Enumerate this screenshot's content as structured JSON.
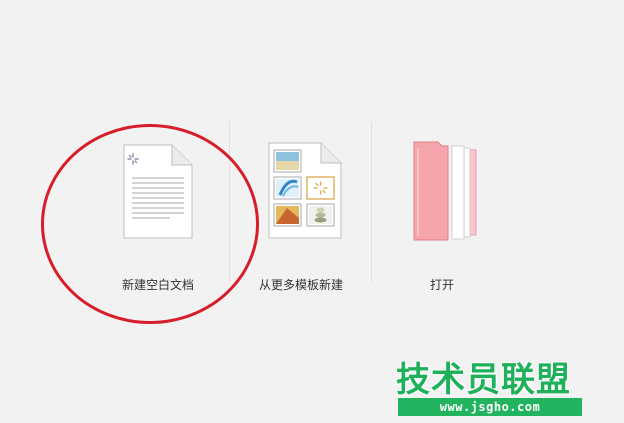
{
  "actions": {
    "new_blank": {
      "label": "新建空白文档",
      "icon": "blank-document-icon"
    },
    "from_template": {
      "label": "从更多模板新建",
      "icon": "template-document-icon"
    },
    "open": {
      "label": "打开",
      "icon": "folder-icon"
    }
  },
  "annotation": {
    "color": "#d81d2a"
  },
  "watermark": {
    "title": "技术员联盟",
    "url": "www.jsgho.com",
    "color": "#1fb05a"
  }
}
